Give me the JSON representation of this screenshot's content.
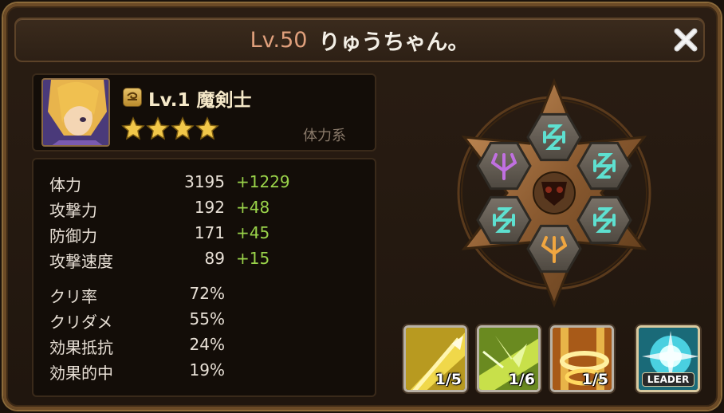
{
  "header": {
    "level": "Lv.50",
    "name": "りゅうちゃん。"
  },
  "monster": {
    "level": "Lv.1",
    "name": "魔剣士",
    "stars": 4,
    "type": "体力系"
  },
  "stats": [
    {
      "label": "体力",
      "value": "3195",
      "bonus": "+1229"
    },
    {
      "label": "攻撃力",
      "value": "192",
      "bonus": "+48"
    },
    {
      "label": "防御力",
      "value": "171",
      "bonus": "+45"
    },
    {
      "label": "攻撃速度",
      "value": "89",
      "bonus": "+15"
    }
  ],
  "secondary_stats": [
    {
      "label": "クリ率",
      "value": "72%"
    },
    {
      "label": "クリダメ",
      "value": "55%"
    },
    {
      "label": "効果抵抗",
      "value": "24%"
    },
    {
      "label": "効果的中",
      "value": "19%"
    }
  ],
  "skills": [
    {
      "level": "1/5",
      "icon": "golden-sword-skill-icon"
    },
    {
      "level": "1/6",
      "icon": "green-slash-skill-icon"
    },
    {
      "level": "1/5",
      "icon": "golden-whirl-skill-icon"
    },
    {
      "leader": "LEADER",
      "icon": "leader-burst-skill-icon"
    }
  ],
  "runes": [
    {
      "slot": 1,
      "icon": "guard-rune-icon",
      "color": "#5ee0d0"
    },
    {
      "slot": 2,
      "icon": "guard-rune-icon",
      "color": "#5ee0d0"
    },
    {
      "slot": 3,
      "icon": "guard-rune-icon",
      "color": "#5ee0d0"
    },
    {
      "slot": 4,
      "icon": "rage-rune-icon",
      "color": "#f0a640"
    },
    {
      "slot": 5,
      "icon": "guard-rune-icon",
      "color": "#5ee0d0"
    },
    {
      "slot": 6,
      "icon": "fatal-rune-icon",
      "color": "#c070e0"
    }
  ],
  "colors": {
    "bonus": "#9ad34a",
    "title_level": "#e0a07c",
    "name": "#f5e8c8"
  }
}
